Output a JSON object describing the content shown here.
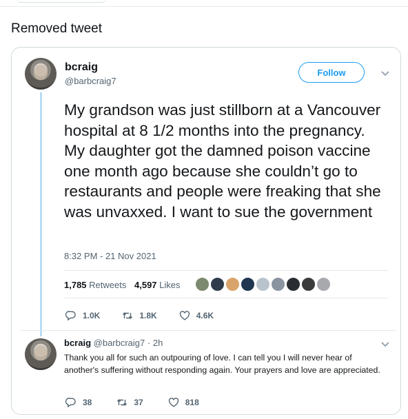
{
  "page": {
    "caption": "Removed tweet"
  },
  "tweet": {
    "name": "bcraig",
    "handle": "@barbcraig7",
    "follow_label": "Follow",
    "text": "My grandson was just stillborn at a Vancouver hospital at 8 1/2 months into the pregnancy. My daughter got the damned poison vaccine one month ago because she couldn’t go to restaurants and people were freaking that she was unvaxxed. I want to sue the government",
    "timestamp": "8:32 PM - 21 Nov 2021",
    "retweets_count": "1,785",
    "retweets_label": "Retweets",
    "likes_count": "4,597",
    "likes_label": "Likes",
    "liker_avatar_colors": [
      "#7b8a6e",
      "#2f3b4a",
      "#d9a46a",
      "#1f3550",
      "#b9c3cc",
      "#8a94a0",
      "#2a2e33",
      "#3b3b3b",
      "#a7a9ad"
    ],
    "actions": {
      "replies": "1.0K",
      "retweets": "1.8K",
      "likes": "4.6K"
    }
  },
  "reply": {
    "name": "bcraig",
    "handle": "@barbcraig7",
    "dot": "·",
    "time": "2h",
    "text": "Thank you all for such an outpouring of love. I can tell you I will never hear of another's suffering without responding again. Your prayers and love are appreciated.",
    "actions": {
      "replies": "38",
      "retweets": "37",
      "likes": "818"
    }
  },
  "colors": {
    "accent": "#1d9bf0",
    "thread_line": "#b7dcf5",
    "muted": "#536471"
  }
}
